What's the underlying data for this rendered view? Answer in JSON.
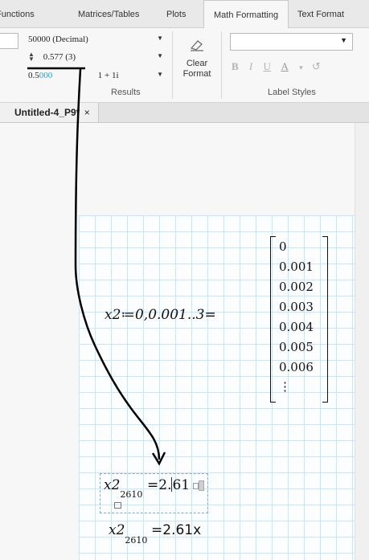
{
  "ribbon_tabs": [
    "Functions",
    "Matrices/Tables",
    "Plots",
    "Math Formatting",
    "Text Format"
  ],
  "active_tab": "Math Formatting",
  "results": {
    "number_format": "50000 (Decimal)",
    "precision": "0.577 (3)",
    "value_prefix": "0.5",
    "value_digits": "000",
    "complex_format": "1 + 1i",
    "group_label": "Results"
  },
  "clear_format": {
    "line1": "Clear",
    "line2": "Format"
  },
  "label_styles": {
    "group_label": "Label Styles",
    "combo_value": "",
    "buttons": [
      "B",
      "I",
      "U",
      "A"
    ]
  },
  "document_tab": {
    "title": "Untitled-4_P9*",
    "close": "×"
  },
  "worksheet": {
    "definition": "x2≔0,0.001..3=",
    "matrix": [
      "0",
      "0.001",
      "0.002",
      "0.003",
      "0.004",
      "0.005",
      "0.006",
      "⋮"
    ],
    "eval1": {
      "var": "x2",
      "sub": "2610",
      "eq": "=",
      "value_a": "2.",
      "value_b": "61"
    },
    "eval2": {
      "var": "x2",
      "sub": "2610",
      "eq": "=",
      "value": "2.61x"
    }
  },
  "colors": {
    "accent": "#2c9ad1",
    "grid_line": "#cfe3f2",
    "ink": "#000000"
  }
}
